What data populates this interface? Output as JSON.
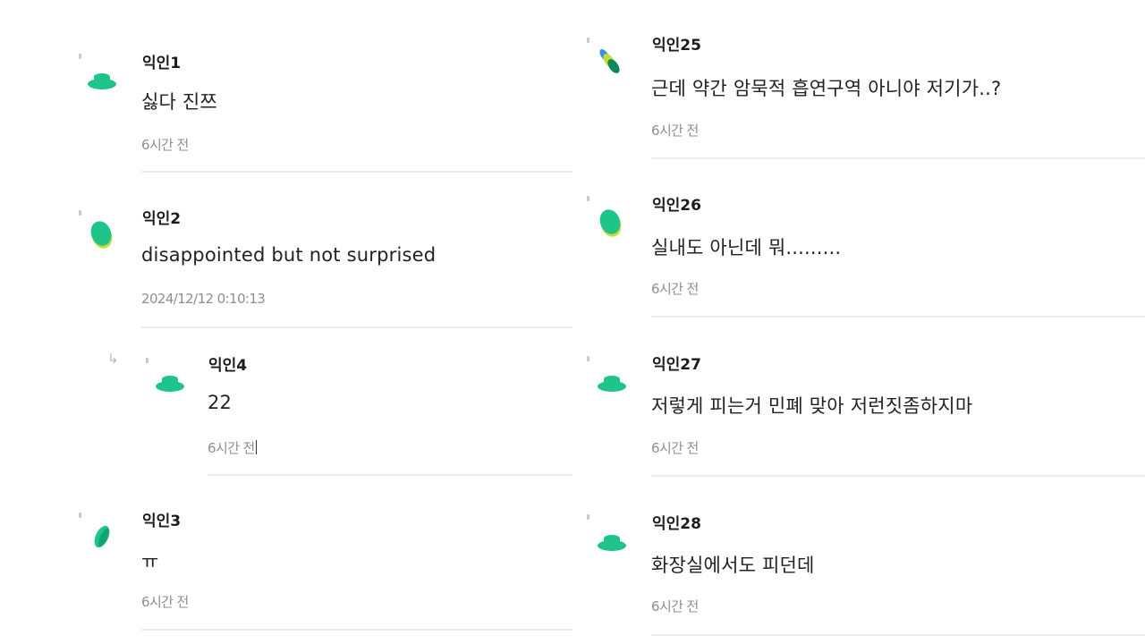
{
  "comments_left": [
    {
      "author": "익인1",
      "text": "싫다 진쯔",
      "time": "6시간 전"
    },
    {
      "author": "익인2",
      "text": "disappointed but not surprised",
      "time": "2024/12/12 0:10:13"
    },
    {
      "author": "익인4",
      "text": "22",
      "time": "6시간 전",
      "reply_arrow": "↳"
    },
    {
      "author": "익인3",
      "text": "ㅠ",
      "time": "6시간 전"
    }
  ],
  "comments_right": [
    {
      "author": "익인25",
      "text": "근데 약간 암묵적 흡연구역 아니야 저기가..?",
      "time": "6시간 전"
    },
    {
      "author": "익인26",
      "text": "실내도 아닌데 뭐.........",
      "time": "6시간 전"
    },
    {
      "author": "익인27",
      "text": "저렇게 피는거 민폐 맞아 저런짓좀하지마",
      "time": "6시간 전"
    },
    {
      "author": "익인28",
      "text": "화장실에서도 피던데",
      "time": "6시간 전"
    }
  ],
  "colors": {
    "avatar_green": "#1fc489",
    "avatar_dark": "#0d8a5c",
    "avatar_lime": "#c7dc3c",
    "avatar_blue": "#3a8fe0",
    "divider": "#ececec"
  }
}
